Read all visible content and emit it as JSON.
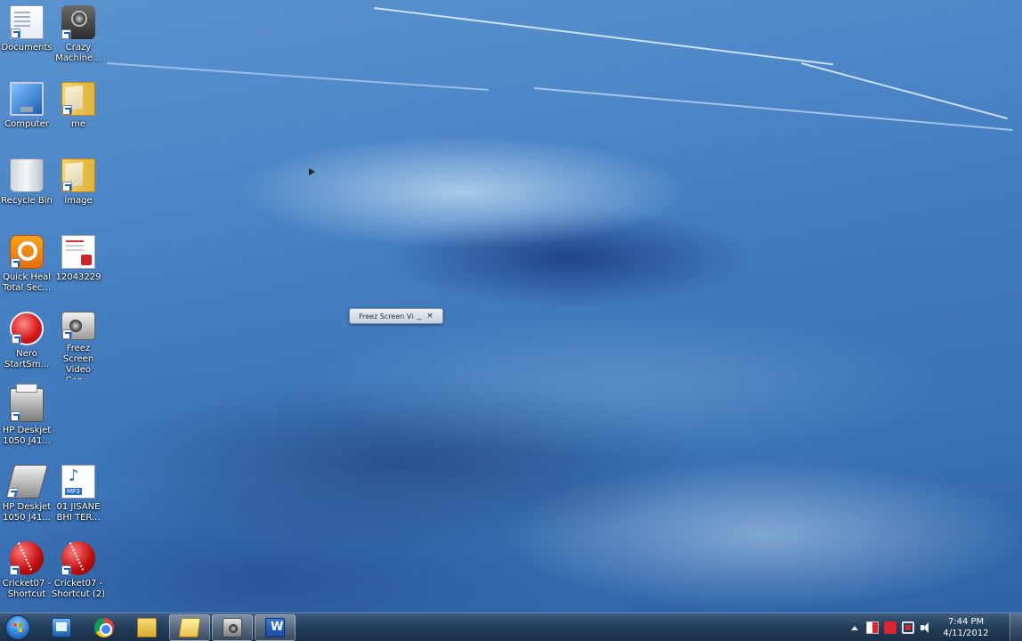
{
  "desktop": {
    "icons": [
      {
        "label": "Documents",
        "icon": "documents-icon"
      },
      {
        "label": "Crazy Machine...",
        "icon": "camera-icon"
      },
      {
        "label": "Computer",
        "icon": "computer-icon"
      },
      {
        "label": "me",
        "icon": "folder-icon"
      },
      {
        "label": "Recycle Bin",
        "icon": "recycle-bin-icon"
      },
      {
        "label": "image",
        "icon": "folder-icon"
      },
      {
        "label": "Quick Heal Total Sec...",
        "icon": "quick-heal-icon"
      },
      {
        "label": "12043229",
        "icon": "pdf-icon"
      },
      {
        "label": "Nero StartSm...",
        "icon": "nero-icon"
      },
      {
        "label": "Freez Screen Video Cap...",
        "icon": "freez-screen-icon"
      },
      {
        "label": "HP Deskjet 1050 J41...",
        "icon": "printer-icon"
      },
      {
        "label": "HP Deskjet 1050 J41...",
        "icon": "scanner-icon"
      },
      {
        "label": "01 JISANE BHI TER...",
        "icon": "mp3-icon"
      },
      {
        "label": "Cricket07 - Shortcut",
        "icon": "cricket-icon"
      },
      {
        "label": "Cricket07 - Shortcut (2)",
        "icon": "cricket-icon"
      }
    ]
  },
  "mini_window": {
    "title": "Freez Screen Vic",
    "minimize": "_",
    "close": "×"
  },
  "taskbar": {
    "start": "start-orb-icon",
    "pinned": [
      "windows-explorer-icon",
      "chrome-icon",
      "folder-icon",
      "folder-open-icon",
      "camera-icon",
      "word-icon"
    ],
    "active_index": 3
  },
  "tray": {
    "time": "7:44 PM",
    "date": "4/11/2012"
  }
}
